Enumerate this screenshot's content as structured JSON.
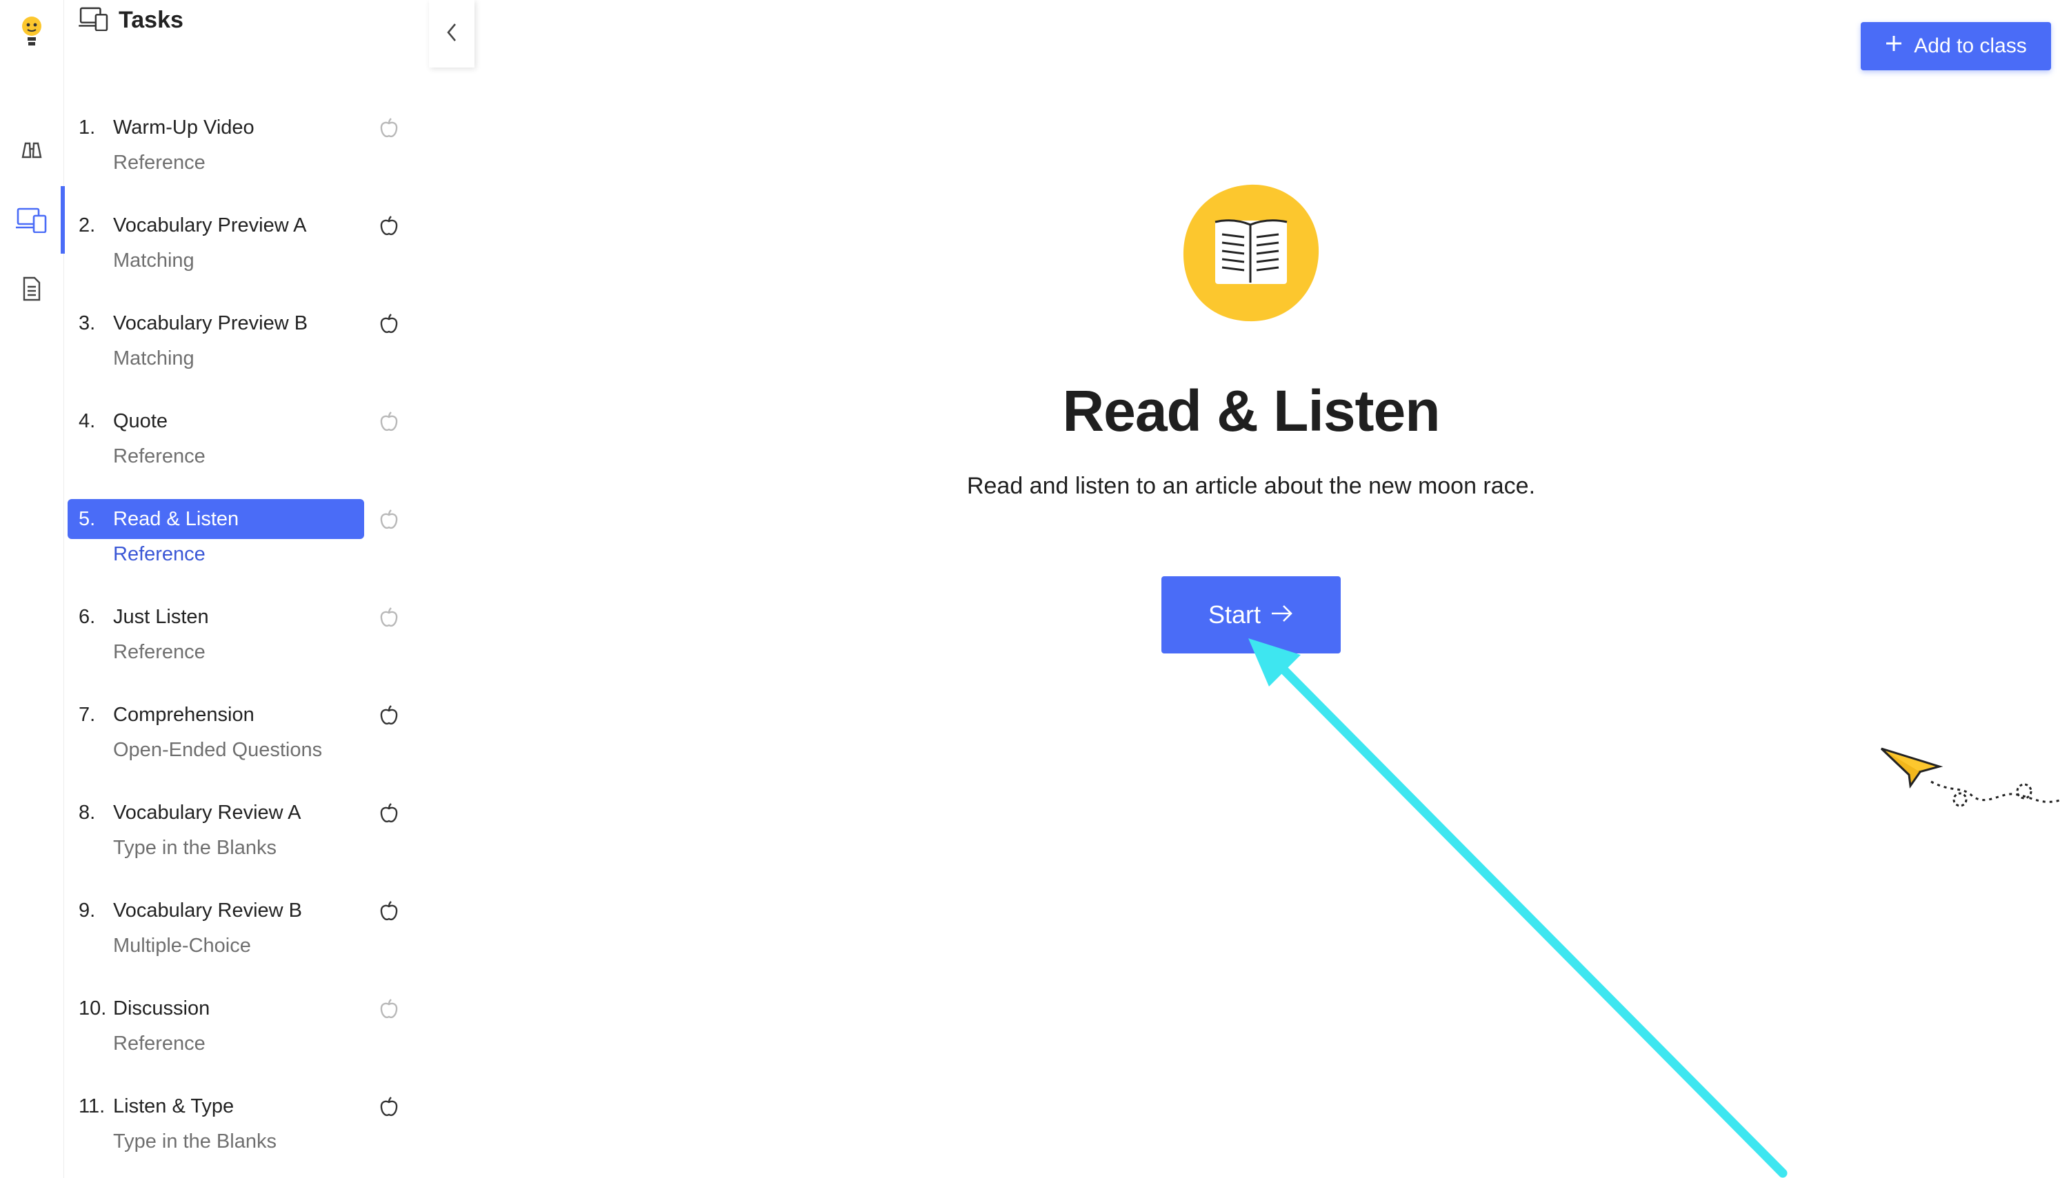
{
  "sidebar": {
    "title": "Tasks",
    "tasks": [
      {
        "num": "1.",
        "name": "Warm-Up Video",
        "type": "Reference",
        "icon": "apple-outline-icon"
      },
      {
        "num": "2.",
        "name": "Vocabulary Preview A",
        "type": "Matching",
        "icon": "apple-icon"
      },
      {
        "num": "3.",
        "name": "Vocabulary Preview B",
        "type": "Matching",
        "icon": "apple-icon"
      },
      {
        "num": "4.",
        "name": "Quote",
        "type": "Reference",
        "icon": "apple-outline-icon"
      },
      {
        "num": "5.",
        "name": "Read & Listen",
        "type": "Reference",
        "icon": "apple-outline-icon",
        "active": true
      },
      {
        "num": "6.",
        "name": "Just Listen",
        "type": "Reference",
        "icon": "apple-outline-icon"
      },
      {
        "num": "7.",
        "name": "Comprehension",
        "type": "Open-Ended Questions",
        "icon": "apple-icon"
      },
      {
        "num": "8.",
        "name": "Vocabulary Review A",
        "type": "Type in the Blanks",
        "icon": "apple-icon"
      },
      {
        "num": "9.",
        "name": "Vocabulary Review B",
        "type": "Multiple-Choice",
        "icon": "apple-icon"
      },
      {
        "num": "10.",
        "name": "Discussion",
        "type": "Reference",
        "icon": "apple-outline-icon"
      },
      {
        "num": "11.",
        "name": "Listen & Type",
        "type": "Type in the Blanks",
        "icon": "apple-icon"
      }
    ]
  },
  "rail": {
    "items": [
      "lightbulb-logo-icon",
      "binoculars-icon",
      "devices-icon",
      "document-icon"
    ],
    "active": "devices-icon"
  },
  "header": {
    "add_to_class_label": "Add to class"
  },
  "activity": {
    "icon": "open-book-icon",
    "title": "Read & Listen",
    "description": "Read and listen to an article about the new moon race.",
    "start_label": "Start"
  },
  "colors": {
    "accent": "#4a6cf7",
    "icon_yellow": "#fcc72e",
    "annotation_arrow": "#3ee6f0"
  }
}
